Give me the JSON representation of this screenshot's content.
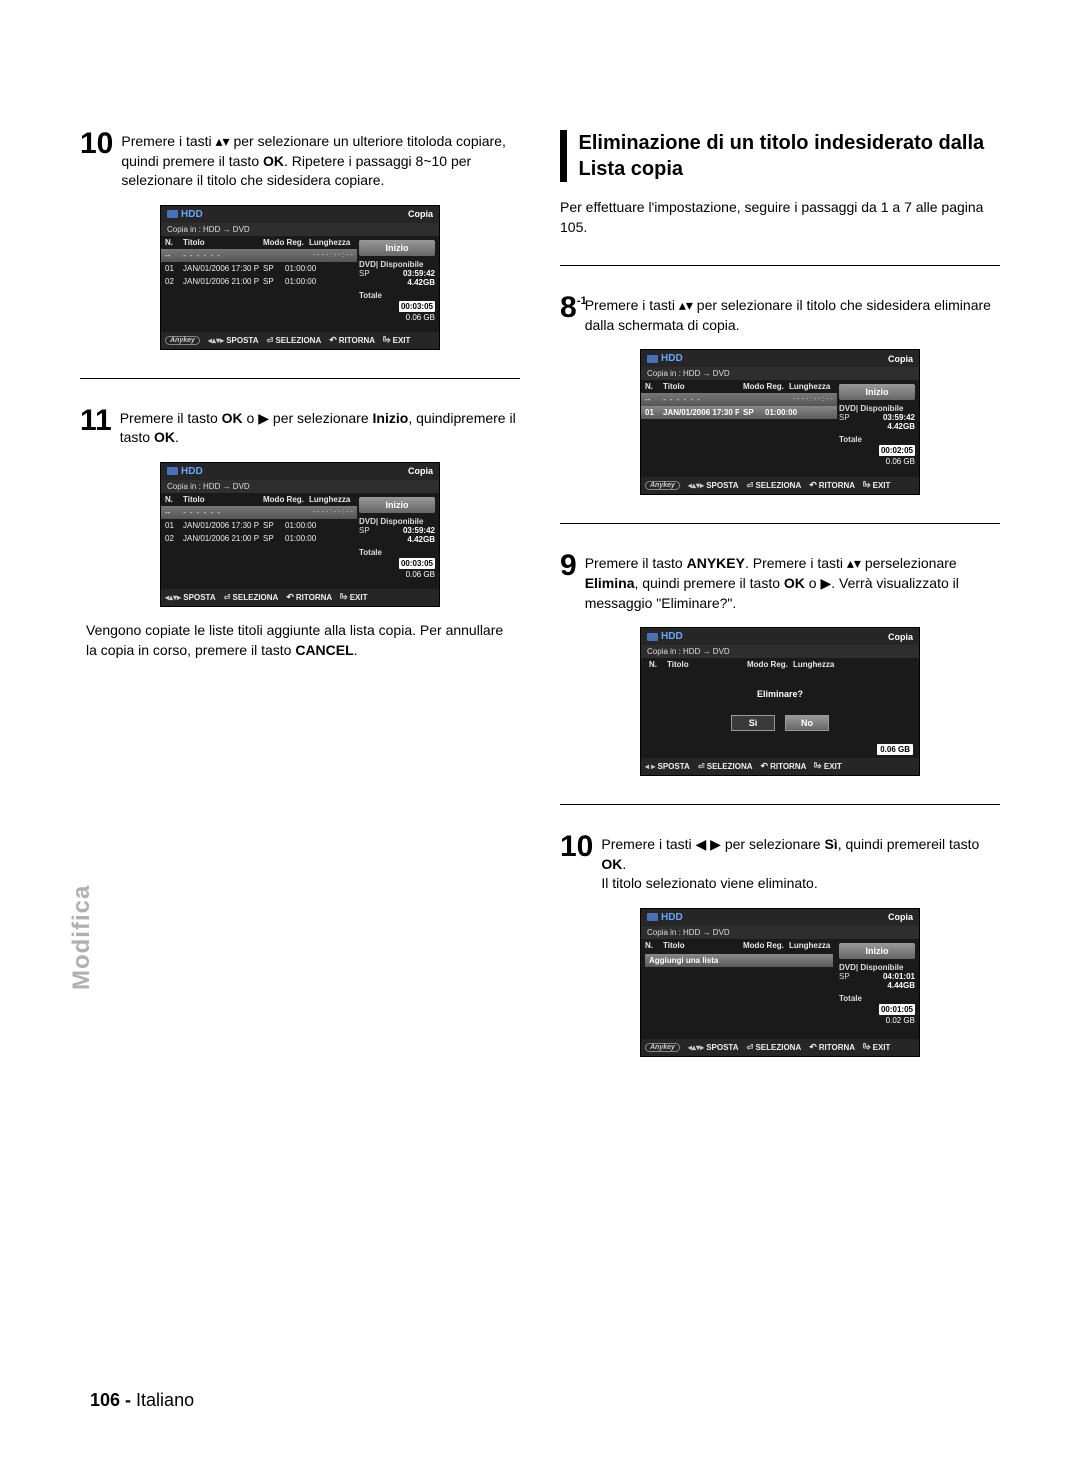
{
  "sideTab": "Modifica",
  "pageNumber": "106 -",
  "pageLang": "Italiano",
  "left": {
    "step10": {
      "num": "10",
      "text_a": "Premere i tasti ",
      "arrows": "▴▾",
      "text_b": " per selezionare un ulteriore titoloda copiare, quindi premere il tasto ",
      "ok": "OK",
      "text_c": ". Ripetere i passaggi 8~10 per selezionare il titolo che sidesidera copiare."
    },
    "step11": {
      "num": "11",
      "text_a": "Premere il tasto ",
      "ok": "OK",
      "text_b": " o ",
      "arrow": "▶",
      "text_c": " per selezionare ",
      "inizio": "Inizio",
      "text_d": ", quindipremere il tasto ",
      "ok2": "OK",
      "text_e": "."
    },
    "afterText": "Vengono copiate le liste titoli aggiunte alla lista copia. Per annullare la copia in corso, premere il tasto ",
    "afterBold": "CANCEL",
    "afterDot": "."
  },
  "right": {
    "heading": "Eliminazione di un titolo indesiderato dalla Lista copia",
    "intro": "Per effettuare l'impostazione, seguire i passaggi da 1 a 7 alle pagina 105.",
    "step8": {
      "num": "8",
      "sup": "-1",
      "text_a": "Premere i tasti ",
      "arrows": "▴▾",
      "text_b": " per selezionare il titolo che sidesidera eliminare dalla schermata di copia."
    },
    "step9": {
      "num": "9",
      "text_a": "Premere il tasto ",
      "anykey": "ANYKEY",
      "text_b": ". Premere i tasti ",
      "arrows": "▴▾",
      "text_c": " perselezionare ",
      "elimina": "Elimina",
      "text_d": ", quindi premere il tasto ",
      "ok": "OK",
      "text_e": " o ",
      "arrow": "▶",
      "text_f": ". Verrà visualizzato il messaggio \"Eliminare?\"."
    },
    "step10": {
      "num": "10",
      "text_a": "Premere i tasti ",
      "arrows": "◀ ▶",
      "text_b": " per selezionare ",
      "si": "Sì",
      "text_c": ", quindi premereil tasto ",
      "ok": "OK",
      "text_d": ".",
      "line2": "Il titolo selezionato viene eliminato."
    }
  },
  "osd": {
    "hdd": "HDD",
    "copia": "Copia",
    "path": "Copia in : HDD  →  DVD",
    "thead": {
      "n": "N.",
      "titolo": "Titolo",
      "modo": "Modo Reg.",
      "len": "Lunghezza"
    },
    "hl_n": "--",
    "hl_dashes": "- - - - - -",
    "hl_marks": "- -   - - : - - : - -",
    "rows": [
      {
        "n": "01",
        "t": "JAN/01/2006 17:30 PR",
        "m": "SP",
        "l": "01:00:00"
      },
      {
        "n": "02",
        "t": "JAN/01/2006 21:00 PR",
        "m": "SP",
        "l": "01:00:00"
      }
    ],
    "row1_only": {
      "n": "01",
      "t": "JAN/01/2006 17:30 PR",
      "m": "SP",
      "l": "01:00:00"
    },
    "addRow": "Aggiungi una lista",
    "side": {
      "inizio": "Inizio",
      "dvdDisp": "DVD| Disponibile",
      "sp": "SP",
      "time1": "03:59:42",
      "gb1": "4.42GB",
      "time2": "04:01:01",
      "gb2": "4.44GB",
      "totale": "Totale",
      "tot_time1": "00:03:05",
      "tot_gb1": "0.06 GB",
      "tot_time2": "00:02:05",
      "tot_gb2": "0.06 GB",
      "tot_time3": "00:01:05",
      "tot_gb3": "0.02 GB"
    },
    "footer": {
      "anykey": "Anykey",
      "sposta_sym": "◂▴▾▸",
      "sposta": "SPOSTA",
      "sel_sym": "⏎",
      "seleziona": "SELEZIONA",
      "ritorna": "RITORNA",
      "exit": "EXIT",
      "sposta_h_sym": "◂ ▸"
    },
    "dialog": {
      "msg": "Eliminare?",
      "si": "Sì",
      "no": "No",
      "gb": "0.06 GB"
    }
  }
}
